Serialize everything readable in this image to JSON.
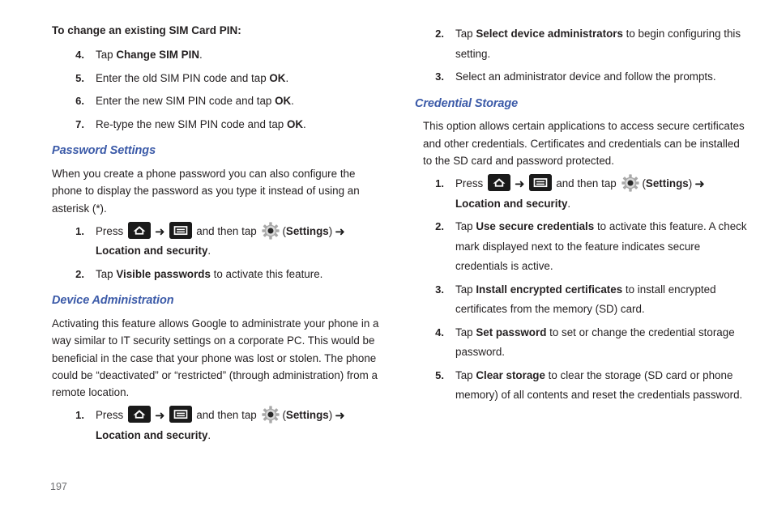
{
  "page": {
    "number": "197",
    "icons": {
      "home": "home-key-icon",
      "menu": "menu-key-icon",
      "gear": "settings-gear-icon",
      "arrow": "➜"
    }
  },
  "left_column": {
    "lead_heading": "To change an existing SIM Card PIN:",
    "sim_steps": [
      {
        "num": "4.",
        "pre": "Tap ",
        "bold": "Change SIM PIN",
        "post": "."
      },
      {
        "num": "5.",
        "pre": "Enter the old SIM PIN code and tap ",
        "bold": "OK",
        "post": "."
      },
      {
        "num": "6.",
        "pre": "Enter the new SIM PIN code and tap ",
        "bold": "OK",
        "post": "."
      },
      {
        "num": "7.",
        "pre": "Re-type the new SIM PIN code and tap ",
        "bold": "OK",
        "post": "."
      }
    ],
    "password_settings": {
      "heading": "Password Settings",
      "body": "When you create a phone password you can also configure the phone to display the password as you type it instead of using an asterisk (*).",
      "step1": {
        "num": "1.",
        "press": "Press ",
        "and_then_tap": " and then tap ",
        "settings_open": "(",
        "settings": "Settings",
        "settings_close": ")",
        "destination": "Location and security",
        "period": "."
      },
      "step2": {
        "num": "2.",
        "pre": "Tap ",
        "bold": "Visible passwords",
        "post": " to activate this feature."
      }
    },
    "device_administration": {
      "heading": "Device Administration",
      "body": "Activating this feature allows Google to administrate your phone in a way similar to IT security settings on a corporate PC. This would be beneficial in the case that your phone was lost or stolen. The phone could be “deactivated” or “restricted” (through administration) from a remote location.",
      "step1": {
        "num": "1.",
        "press": "Press ",
        "and_then_tap": " and then tap ",
        "settings_open": "(",
        "settings": "Settings",
        "settings_close": ")",
        "destination": "Location and security",
        "period": "."
      }
    }
  },
  "right_column": {
    "device_admin_steps": [
      {
        "num": "2.",
        "pre": "Tap ",
        "bold": "Select device administrators",
        "post": " to begin configuring this setting."
      },
      {
        "num": "3.",
        "pre": "Select an administrator device and follow the prompts.",
        "bold": "",
        "post": ""
      }
    ],
    "credential_storage": {
      "heading": "Credential Storage",
      "body": "This option allows certain applications to access secure certificates and other credentials. Certificates and credentials can be installed to the SD card and password protected.",
      "step1": {
        "num": "1.",
        "press": "Press ",
        "and_then_tap": " and then tap ",
        "settings_open": "(",
        "settings": "Settings",
        "settings_close": ")",
        "destination": "Location and security",
        "period": "."
      },
      "steps": [
        {
          "num": "2.",
          "pre": "Tap ",
          "bold": "Use secure credentials",
          "post": " to activate this feature. A check mark displayed next to the feature indicates secure credentials is active."
        },
        {
          "num": "3.",
          "pre": "Tap ",
          "bold": "Install encrypted certificates",
          "post": " to install encrypted certificates from the memory (SD) card."
        },
        {
          "num": "4.",
          "pre": "Tap ",
          "bold": "Set password",
          "post": " to set or change the credential storage password."
        },
        {
          "num": "5.",
          "pre": "Tap ",
          "bold": "Clear storage",
          "post": " to clear the storage (SD card or phone memory) of all contents and reset the credentials password."
        }
      ]
    }
  },
  "colors": {
    "heading_blue": "#3b5aa8",
    "body_text": "#231f20",
    "folio_gray": "#6d6e71",
    "key_black": "#1a1a1a",
    "gear_gray": "#a8a8a8"
  }
}
